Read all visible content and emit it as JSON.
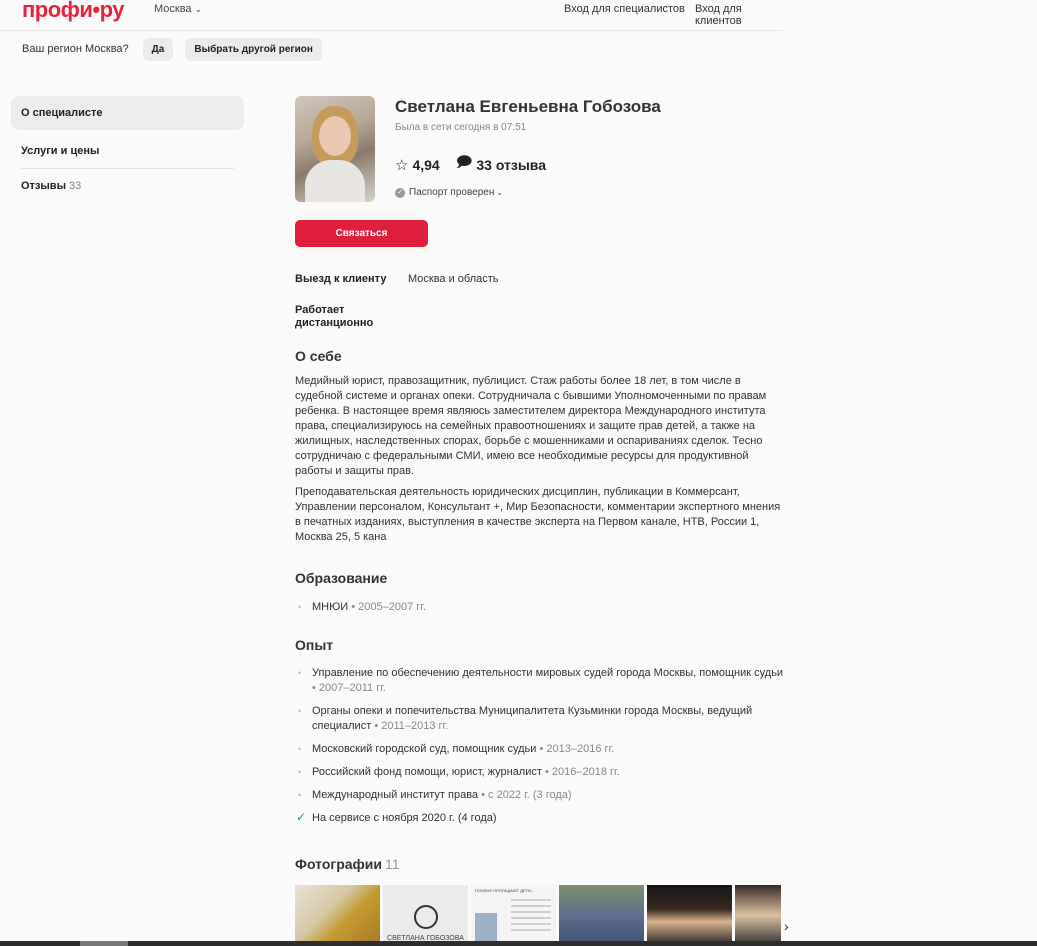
{
  "header": {
    "logo": "профи.ру",
    "logo_parts": [
      "профи",
      "•",
      "ру"
    ],
    "city": "Москва",
    "login_specialists": "Вход для специалистов",
    "login_clients": "Вход для клиентов"
  },
  "region_bar": {
    "question": "Ваш регион Москва?",
    "yes_label": "Да",
    "other_label": "Выбрать другой регион"
  },
  "sidebar": {
    "items": [
      {
        "label": "О специалисте",
        "active": true
      },
      {
        "label": "Услуги и цены"
      },
      {
        "label": "Отзывы",
        "count": "33"
      }
    ]
  },
  "profile": {
    "name": "Светлана Евгеньевна Гобозова",
    "online": "Была в сети сегодня в 07:51",
    "rating": "4,94",
    "reviews": "33 отзыва",
    "passport": "Паспорт проверен",
    "contact_label": "Связаться"
  },
  "details": {
    "visit_key": "Выезд к клиенту",
    "visit_value": "Москва и область",
    "remote_line1": "Работает",
    "remote_line2": "дистанционно"
  },
  "about": {
    "title": "О себе",
    "p1": "Медийный юрист, правозащитник, публицист. Стаж работы более 18 лет, в том числе в судебной системе и органах опеки. Сотрудничала с бывшими Уполномоченными по правам ребенка. В настоящее время являюсь заместителем директора Международного института права, специализируюсь на семейных правоотношениях и защите прав детей, а также на жилищных, наследственных спорах, борьбе с мошенниками и оспариваниях сделок. Тесно сотрудничаю с федеральными СМИ, имею все необходимые ресурсы для продуктивной работы и защиты прав.",
    "p2": "Преподавательская деятельность юридических дисциплин, публикации в Коммерсант, Управлении персоналом, Консультант +, Мир Безопасности, комментарии экспертного мнения в печатных изданиях, выступления в качестве эксперта на Первом канале, НТВ, России 1, Москва 25, 5 кана"
  },
  "education": {
    "title": "Образование",
    "items": [
      {
        "text": "МНЮИ",
        "date": "2005–2007 гг."
      }
    ]
  },
  "experience": {
    "title": "Опыт",
    "items": [
      {
        "text": "Управление по обеспечению деятельности мировых судей города Москвы, помощник судьи",
        "date": "2007–2011 гг."
      },
      {
        "text": "Органы опеки и попечительства Муниципалитета Кузьминки города Москвы, ведущий специалист",
        "date": "2011–2013 гг."
      },
      {
        "text": "Московский городской суд, помощник судьи",
        "date": "2013–2016 гг."
      },
      {
        "text": "Российский фонд помощи, юрист, журналист",
        "date": "2016–2018 гг."
      },
      {
        "text": "Международный институт права",
        "date": "с 2022 г. (3 года)"
      }
    ],
    "service": "На сервисе с ноября 2020 г. (4 года)"
  },
  "photos": {
    "title": "Фотографии",
    "count": "11",
    "photo2_caption": "СВЕТЛАНА ГОБОЗОВА",
    "photo3_title": "ПОЧЕМУ ПРОПАДАЮТ ДЕТИ..."
  }
}
